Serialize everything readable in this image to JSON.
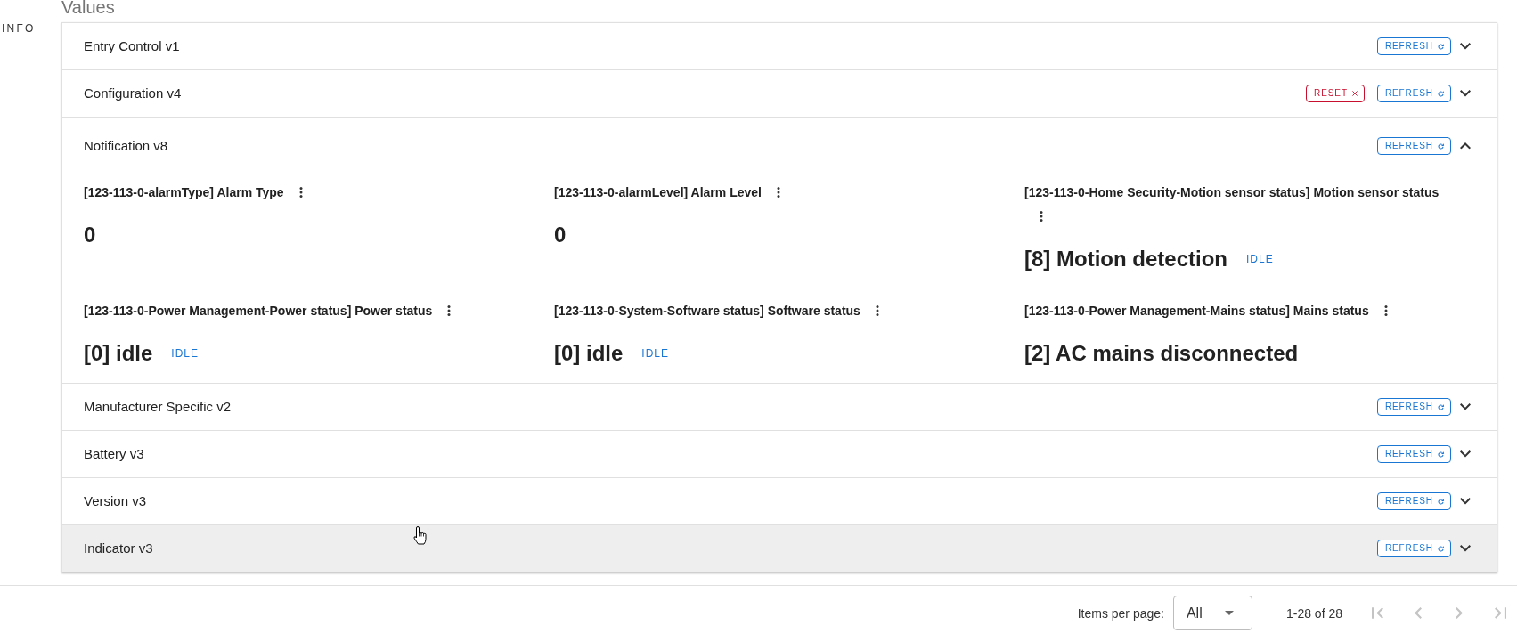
{
  "sidebar": {
    "label": "INFO"
  },
  "heading": "Values",
  "sections": [
    {
      "title": "Entry Control v1",
      "expanded": false,
      "hovered": false,
      "buttons": [
        {
          "kind": "refresh",
          "label": "REFRESH"
        }
      ]
    },
    {
      "title": "Configuration v4",
      "expanded": false,
      "hovered": false,
      "buttons": [
        {
          "kind": "reset",
          "label": "RESET"
        },
        {
          "kind": "refresh",
          "label": "REFRESH"
        }
      ]
    },
    {
      "title": "Notification v8",
      "expanded": true,
      "hovered": false,
      "buttons": [
        {
          "kind": "refresh",
          "label": "REFRESH"
        }
      ],
      "values": [
        {
          "label": "[123-113-0-alarmType] Alarm Type",
          "value": "0"
        },
        {
          "label": "[123-113-0-alarmLevel] Alarm Level",
          "value": "0"
        },
        {
          "label": "[123-113-0-Home Security-Motion sensor status] Motion sensor status",
          "value": "[8] Motion detection",
          "action": "IDLE"
        },
        {
          "label": "[123-113-0-Power Management-Power status] Power status",
          "value": "[0] idle",
          "action": "IDLE"
        },
        {
          "label": "[123-113-0-System-Software status] Software status",
          "value": "[0] idle",
          "action": "IDLE"
        },
        {
          "label": "[123-113-0-Power Management-Mains status] Mains status",
          "value": "[2] AC mains disconnected"
        }
      ]
    },
    {
      "title": "Manufacturer Specific v2",
      "expanded": false,
      "hovered": false,
      "buttons": [
        {
          "kind": "refresh",
          "label": "REFRESH"
        }
      ]
    },
    {
      "title": "Battery v3",
      "expanded": false,
      "hovered": false,
      "buttons": [
        {
          "kind": "refresh",
          "label": "REFRESH"
        }
      ]
    },
    {
      "title": "Version v3",
      "expanded": false,
      "hovered": false,
      "buttons": [
        {
          "kind": "refresh",
          "label": "REFRESH"
        }
      ]
    },
    {
      "title": "Indicator v3",
      "expanded": false,
      "hovered": true,
      "buttons": [
        {
          "kind": "refresh",
          "label": "REFRESH"
        }
      ]
    }
  ],
  "pagination": {
    "items_per_page_label": "Items per page:",
    "items_per_page": "All",
    "range": "1-28 of 28",
    "buttons": [
      {
        "kind": "first",
        "disabled": true
      },
      {
        "kind": "previous",
        "disabled": true
      },
      {
        "kind": "next",
        "disabled": true
      },
      {
        "kind": "last",
        "disabled": true
      }
    ]
  }
}
